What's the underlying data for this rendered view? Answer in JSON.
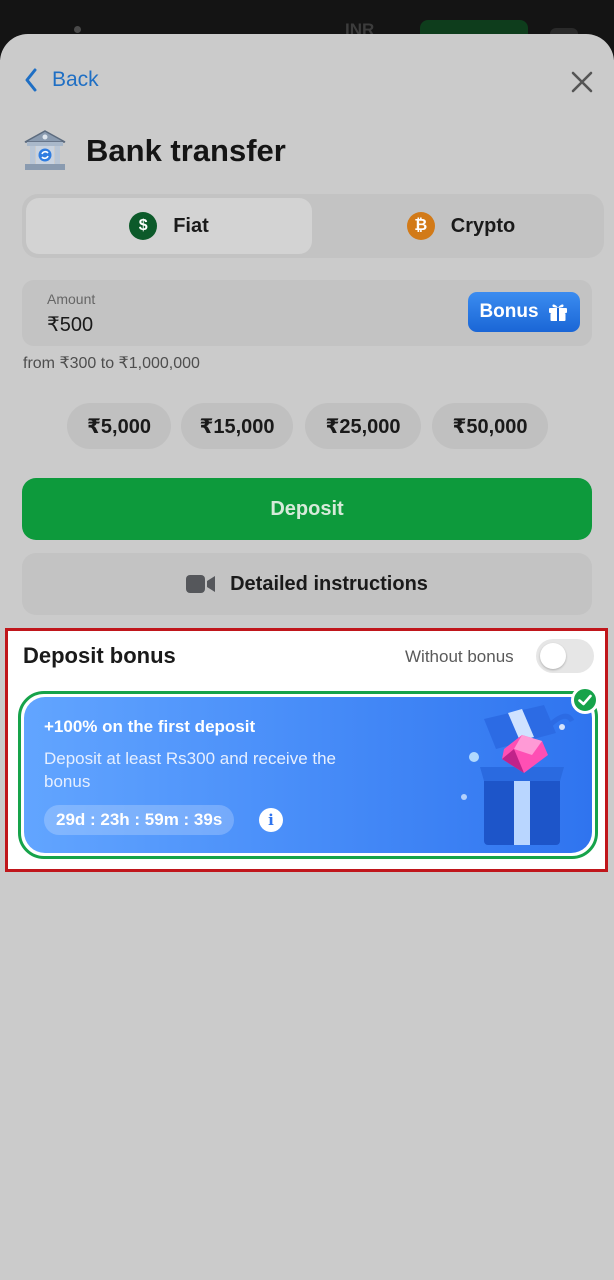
{
  "background": {
    "currency_label": "INR"
  },
  "header": {
    "back_label": "Back",
    "title": "Bank transfer"
  },
  "method_tabs": [
    {
      "label": "Fiat",
      "icon": "dollar-coin-icon",
      "selected": true
    },
    {
      "label": "Crypto",
      "icon": "bitcoin-icon",
      "selected": false
    }
  ],
  "amount": {
    "label": "Amount",
    "value": "₹500",
    "bonus_button_label": "Bonus",
    "range_text": "from ₹300 to ₹1,000,000"
  },
  "quick_amounts": [
    "₹5,000",
    "₹15,000",
    "₹25,000",
    "₹50,000"
  ],
  "actions": {
    "deposit_label": "Deposit",
    "instructions_label": "Detailed instructions"
  },
  "deposit_bonus": {
    "heading": "Deposit bonus",
    "without_bonus_label": "Without bonus",
    "without_bonus_enabled": false,
    "offer": {
      "title": "+100% on the first deposit",
      "description": "Deposit at least Rs300 and receive the bonus",
      "timer": "29d : 23h : 59m : 39s",
      "selected": true
    }
  },
  "colors": {
    "accent_blue": "#1f6fc4",
    "deposit_green": "#0d9a3c",
    "highlight_red": "#c0161b",
    "selected_green": "#16a34a"
  }
}
